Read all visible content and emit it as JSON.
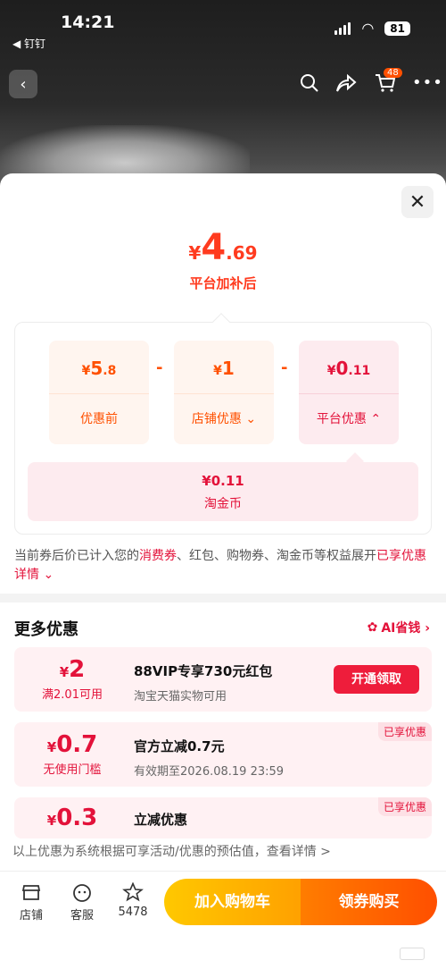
{
  "status": {
    "time": "14:21",
    "back_app": "◀ 钉钉",
    "battery": "81"
  },
  "nav": {
    "cart_badge": "48"
  },
  "sheet": {
    "final_price": {
      "currency": "¥",
      "integer": "4",
      "decimal": ".69",
      "label": "平台加补后"
    },
    "breakdown": {
      "original": {
        "currency": "¥",
        "integer": "5",
        "decimal": ".8",
        "label": "优惠前"
      },
      "store": {
        "currency": "¥",
        "integer": "1",
        "decimal": "",
        "label": "店铺优惠"
      },
      "platform": {
        "currency": "¥",
        "integer": "0",
        "decimal": ".11",
        "label": "平台优惠"
      },
      "minus": "-",
      "coin": {
        "value": "¥0.11",
        "label": "淘金币"
      }
    },
    "note": {
      "part1": "当前券后价已计入您的",
      "highlight1": "消费券",
      "part2": "、红包、购物券、淘金币等权益展开",
      "highlight2": "已享优惠详情"
    },
    "more": {
      "title": "更多优惠",
      "ai_label": "AI省钱 ›"
    },
    "coupons": [
      {
        "currency": "¥",
        "amount": "2",
        "condition": "满2.01可用",
        "title": "88VIP专享730元红包",
        "subtitle": "淘宝天猫实物可用",
        "button": "开通领取"
      },
      {
        "currency": "¥",
        "amount": "0.7",
        "condition": "无使用门槛",
        "title": "官方立减0.7元",
        "subtitle": "有效期至2026.08.19 23:59",
        "tag": "已享优惠"
      },
      {
        "currency": "¥",
        "amount": "0.3",
        "title": "立减优惠",
        "tag": "已享优惠"
      }
    ],
    "footer_note": "以上优惠为系统根据可享活动/优惠的预估值，查看详情 >"
  },
  "bottom": {
    "store": "店铺",
    "service": "客服",
    "favorites": "5478",
    "add_cart": "加入购物车",
    "buy": "领券购买"
  },
  "colors": {
    "accent": "#ff5000",
    "red": "#e3123a"
  }
}
